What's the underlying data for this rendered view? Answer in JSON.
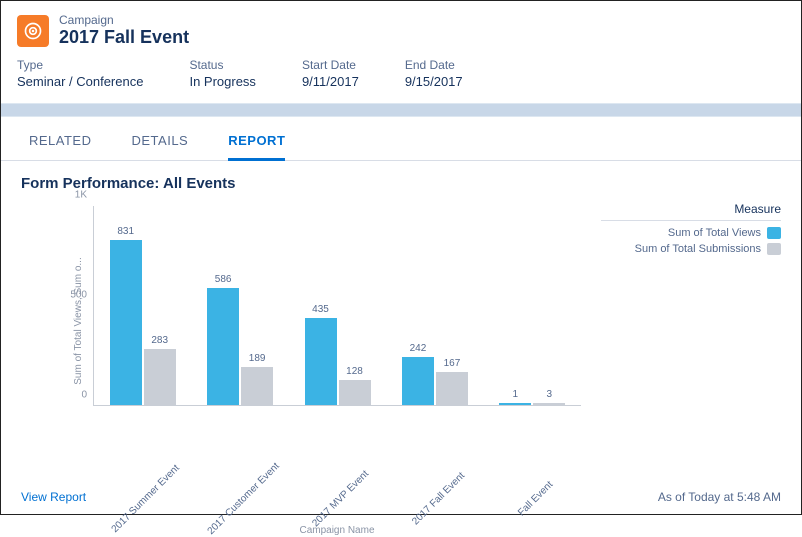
{
  "header": {
    "eyebrow": "Campaign",
    "title": "2017 Fall Event"
  },
  "meta": {
    "type_label": "Type",
    "type_value": "Seminar / Conference",
    "status_label": "Status",
    "status_value": "In Progress",
    "start_label": "Start Date",
    "start_value": "9/11/2017",
    "end_label": "End Date",
    "end_value": "9/15/2017"
  },
  "tabs": {
    "related": "RELATED",
    "details": "DETAILS",
    "report": "REPORT"
  },
  "report": {
    "title": "Form Performance: All Events",
    "view_report": "View Report",
    "as_of": "As of Today at 5:48 AM",
    "y_axis_label": "Sum of Total Views, Sum o...",
    "x_axis_label": "Campaign Name",
    "legend_title": "Measure",
    "legend_views": "Sum of Total Views",
    "legend_subs": "Sum of Total Submissions",
    "y_ticks": [
      "0",
      "500",
      "1K"
    ]
  },
  "chart_data": {
    "type": "bar",
    "categories": [
      "2017 Summer Event",
      "2017 Customer Event",
      "2017 MVP Event",
      "2017 Fall Event",
      "Fall Event"
    ],
    "series": [
      {
        "name": "Sum of Total Views",
        "values": [
          831,
          586,
          435,
          242,
          1
        ]
      },
      {
        "name": "Sum of Total Submissions",
        "values": [
          283,
          189,
          128,
          167,
          3
        ]
      }
    ],
    "title": "Form Performance: All Events",
    "xlabel": "Campaign Name",
    "ylabel": "Sum of Total Views, Sum of Total Submissions",
    "ylim": [
      0,
      1000
    ]
  }
}
